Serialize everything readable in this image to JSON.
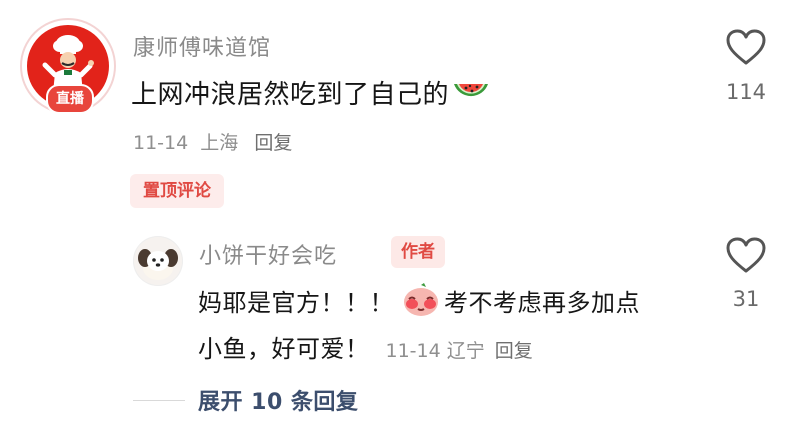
{
  "top_comment": {
    "author": "康师傅味道馆",
    "live_badge": "直播",
    "text": "上网冲浪居然吃到了自己的",
    "emoji_icon": "watermelon-emoji",
    "date": "11-14",
    "location": "上海",
    "reply_label": "回复",
    "pin_label": "置顶评论",
    "like_count": "114"
  },
  "reply": {
    "author": "小饼干好会吃",
    "author_tag": "作者",
    "text_part1": "妈耶是官方！！！",
    "emoji_icon": "blushing-peach-emoji",
    "text_part2": "考不考虑再多加点",
    "text_line2": "小鱼，好可爱！",
    "date": "11-14",
    "location": "辽宁",
    "reply_label": "回复",
    "like_count": "31"
  },
  "expand_replies": "展开 10 条回复",
  "colors": {
    "accent_red": "#e04a43",
    "tag_bg": "#fdeceb",
    "link_blue": "#3c4e6d"
  }
}
